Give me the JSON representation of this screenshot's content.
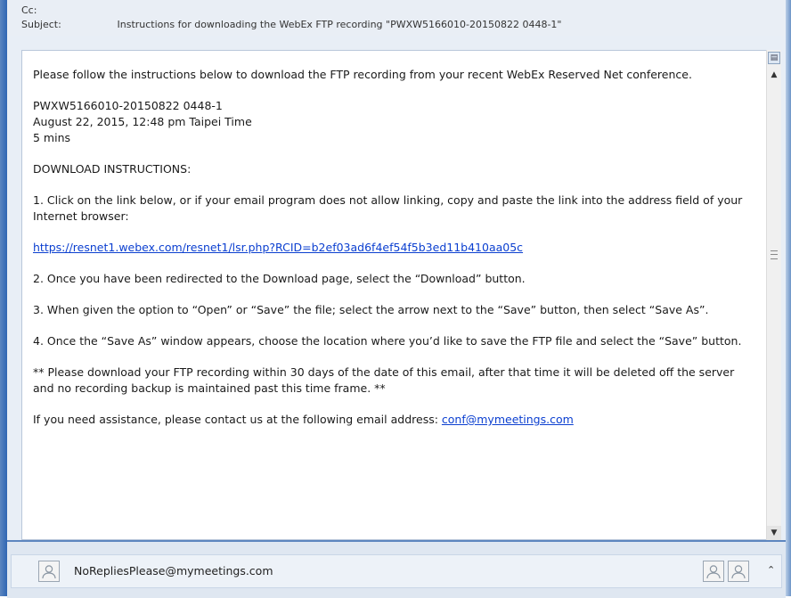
{
  "header": {
    "cc_label": "Cc:",
    "subject_label": "Subject:",
    "subject_value": "Instructions for downloading the WebEx FTP recording \"PWXW5166010-20150822 0448-1\""
  },
  "body": {
    "intro": "Please follow the instructions below to download the FTP recording from your recent WebEx Reserved Net conference.",
    "recording_id": "PWXW5166010-20150822 0448-1",
    "recording_date": "August 22, 2015, 12:48 pm Taipei Time",
    "duration": "5 mins",
    "instructions_heading": "DOWNLOAD INSTRUCTIONS:",
    "step1": "1. Click on the link below, or if your email program does not allow linking, copy and paste the link into the address field of your Internet browser:",
    "download_link": "https://resnet1.webex.com/resnet1/lsr.php?RCID=b2ef03ad6f4ef54f5b3ed11b410aa05c",
    "step2": "2. Once you have been redirected to the Download page, select the “Download” button.",
    "step3": "3. When given the option to “Open” or “Save” the file; select the arrow next to the “Save” button, then select “Save As”.",
    "step4": "4. Once the “Save As” window appears, choose the location where you’d like to save the FTP file and select the “Save” button.",
    "notice": "** Please download your FTP recording within 30 days of the date of this email, after that time it will be deleted off the server and no recording backup is maintained past this time frame. **",
    "assistance_text": "If you need assistance, please contact us at the following email address: ",
    "assistance_email": "conf@mymeetings.com"
  },
  "footer": {
    "sender": "NoRepliesPlease@mymeetings.com"
  },
  "icons": {
    "scroll_up": "arrow-up-icon",
    "scroll_down": "arrow-down-icon",
    "expand": "chevron-up-icon",
    "avatar": "person-icon"
  }
}
